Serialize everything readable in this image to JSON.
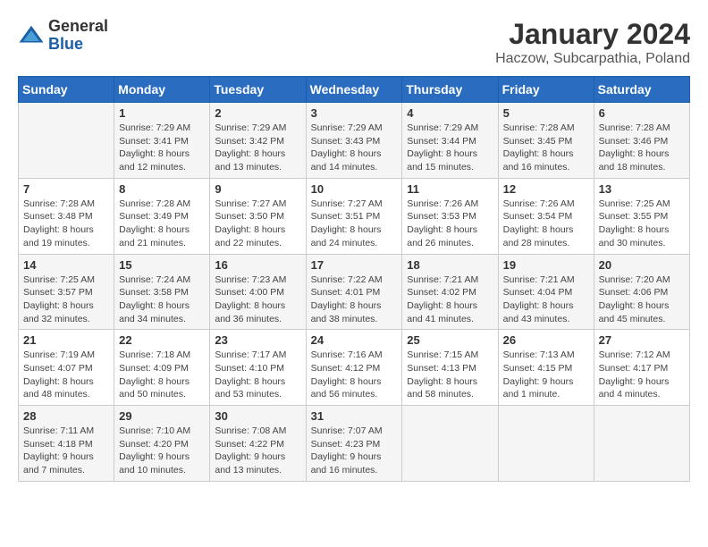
{
  "logo": {
    "general": "General",
    "blue": "Blue"
  },
  "title": {
    "month": "January 2024",
    "location": "Haczow, Subcarpathia, Poland"
  },
  "days_of_week": [
    "Sunday",
    "Monday",
    "Tuesday",
    "Wednesday",
    "Thursday",
    "Friday",
    "Saturday"
  ],
  "weeks": [
    [
      {
        "day": "",
        "info": ""
      },
      {
        "day": "1",
        "info": "Sunrise: 7:29 AM\nSunset: 3:41 PM\nDaylight: 8 hours and 12 minutes."
      },
      {
        "day": "2",
        "info": "Sunrise: 7:29 AM\nSunset: 3:42 PM\nDaylight: 8 hours and 13 minutes."
      },
      {
        "day": "3",
        "info": "Sunrise: 7:29 AM\nSunset: 3:43 PM\nDaylight: 8 hours and 14 minutes."
      },
      {
        "day": "4",
        "info": "Sunrise: 7:29 AM\nSunset: 3:44 PM\nDaylight: 8 hours and 15 minutes."
      },
      {
        "day": "5",
        "info": "Sunrise: 7:28 AM\nSunset: 3:45 PM\nDaylight: 8 hours and 16 minutes."
      },
      {
        "day": "6",
        "info": "Sunrise: 7:28 AM\nSunset: 3:46 PM\nDaylight: 8 hours and 18 minutes."
      }
    ],
    [
      {
        "day": "7",
        "info": "Sunrise: 7:28 AM\nSunset: 3:48 PM\nDaylight: 8 hours and 19 minutes."
      },
      {
        "day": "8",
        "info": "Sunrise: 7:28 AM\nSunset: 3:49 PM\nDaylight: 8 hours and 21 minutes."
      },
      {
        "day": "9",
        "info": "Sunrise: 7:27 AM\nSunset: 3:50 PM\nDaylight: 8 hours and 22 minutes."
      },
      {
        "day": "10",
        "info": "Sunrise: 7:27 AM\nSunset: 3:51 PM\nDaylight: 8 hours and 24 minutes."
      },
      {
        "day": "11",
        "info": "Sunrise: 7:26 AM\nSunset: 3:53 PM\nDaylight: 8 hours and 26 minutes."
      },
      {
        "day": "12",
        "info": "Sunrise: 7:26 AM\nSunset: 3:54 PM\nDaylight: 8 hours and 28 minutes."
      },
      {
        "day": "13",
        "info": "Sunrise: 7:25 AM\nSunset: 3:55 PM\nDaylight: 8 hours and 30 minutes."
      }
    ],
    [
      {
        "day": "14",
        "info": "Sunrise: 7:25 AM\nSunset: 3:57 PM\nDaylight: 8 hours and 32 minutes."
      },
      {
        "day": "15",
        "info": "Sunrise: 7:24 AM\nSunset: 3:58 PM\nDaylight: 8 hours and 34 minutes."
      },
      {
        "day": "16",
        "info": "Sunrise: 7:23 AM\nSunset: 4:00 PM\nDaylight: 8 hours and 36 minutes."
      },
      {
        "day": "17",
        "info": "Sunrise: 7:22 AM\nSunset: 4:01 PM\nDaylight: 8 hours and 38 minutes."
      },
      {
        "day": "18",
        "info": "Sunrise: 7:21 AM\nSunset: 4:02 PM\nDaylight: 8 hours and 41 minutes."
      },
      {
        "day": "19",
        "info": "Sunrise: 7:21 AM\nSunset: 4:04 PM\nDaylight: 8 hours and 43 minutes."
      },
      {
        "day": "20",
        "info": "Sunrise: 7:20 AM\nSunset: 4:06 PM\nDaylight: 8 hours and 45 minutes."
      }
    ],
    [
      {
        "day": "21",
        "info": "Sunrise: 7:19 AM\nSunset: 4:07 PM\nDaylight: 8 hours and 48 minutes."
      },
      {
        "day": "22",
        "info": "Sunrise: 7:18 AM\nSunset: 4:09 PM\nDaylight: 8 hours and 50 minutes."
      },
      {
        "day": "23",
        "info": "Sunrise: 7:17 AM\nSunset: 4:10 PM\nDaylight: 8 hours and 53 minutes."
      },
      {
        "day": "24",
        "info": "Sunrise: 7:16 AM\nSunset: 4:12 PM\nDaylight: 8 hours and 56 minutes."
      },
      {
        "day": "25",
        "info": "Sunrise: 7:15 AM\nSunset: 4:13 PM\nDaylight: 8 hours and 58 minutes."
      },
      {
        "day": "26",
        "info": "Sunrise: 7:13 AM\nSunset: 4:15 PM\nDaylight: 9 hours and 1 minute."
      },
      {
        "day": "27",
        "info": "Sunrise: 7:12 AM\nSunset: 4:17 PM\nDaylight: 9 hours and 4 minutes."
      }
    ],
    [
      {
        "day": "28",
        "info": "Sunrise: 7:11 AM\nSunset: 4:18 PM\nDaylight: 9 hours and 7 minutes."
      },
      {
        "day": "29",
        "info": "Sunrise: 7:10 AM\nSunset: 4:20 PM\nDaylight: 9 hours and 10 minutes."
      },
      {
        "day": "30",
        "info": "Sunrise: 7:08 AM\nSunset: 4:22 PM\nDaylight: 9 hours and 13 minutes."
      },
      {
        "day": "31",
        "info": "Sunrise: 7:07 AM\nSunset: 4:23 PM\nDaylight: 9 hours and 16 minutes."
      },
      {
        "day": "",
        "info": ""
      },
      {
        "day": "",
        "info": ""
      },
      {
        "day": "",
        "info": ""
      }
    ]
  ]
}
